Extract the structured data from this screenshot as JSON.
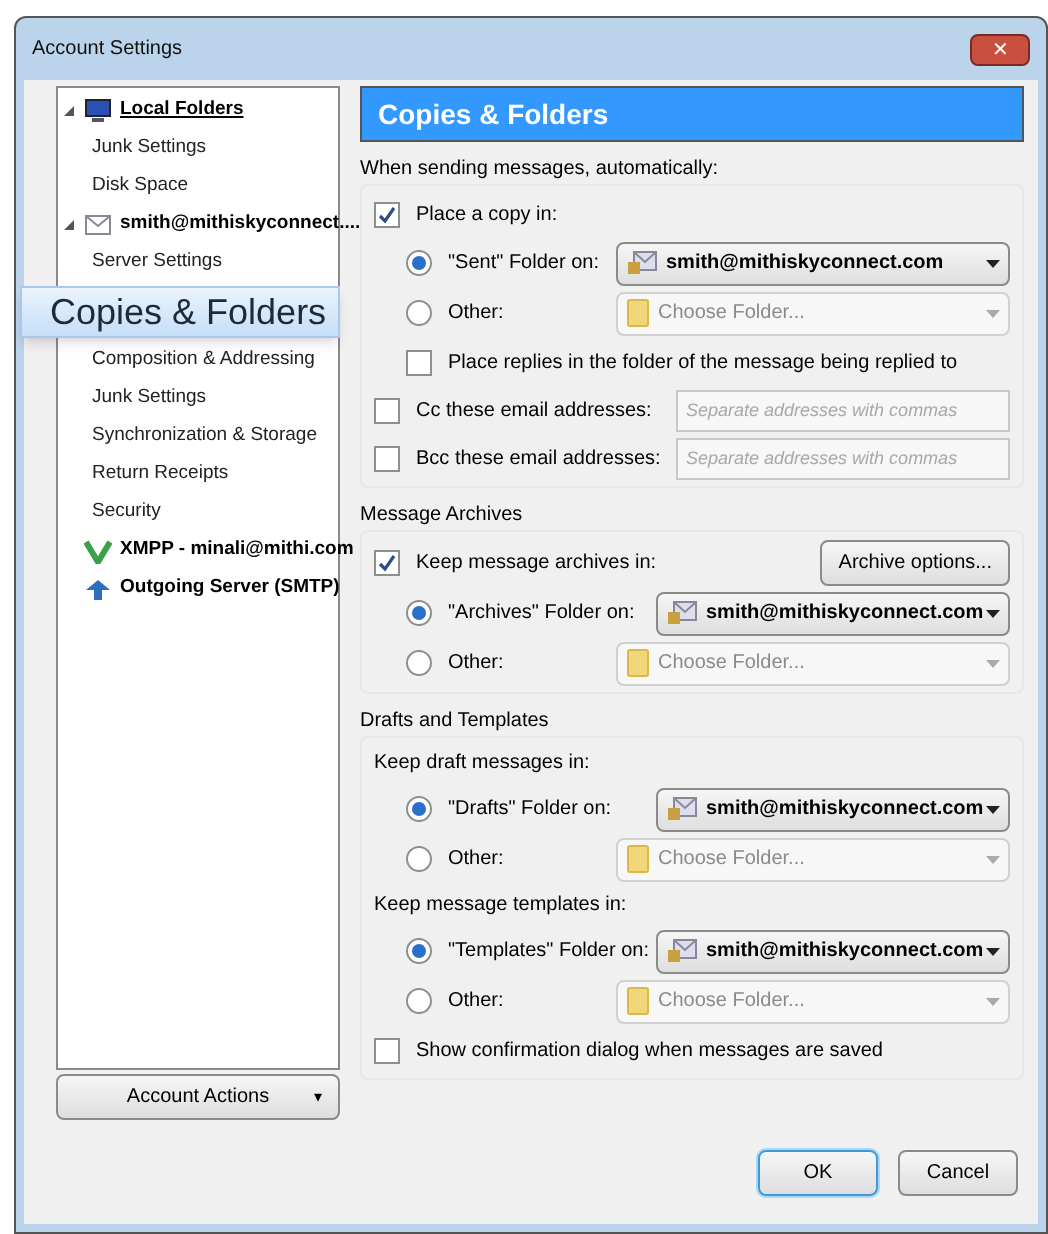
{
  "window": {
    "title": "Account Settings",
    "close": "✕"
  },
  "sidebar": {
    "items": [
      {
        "label": "Local Folders",
        "kind": "local",
        "expanded": true,
        "selected": false,
        "children": [
          {
            "label": "Junk Settings",
            "selected": false
          },
          {
            "label": "Disk Space",
            "selected": false
          }
        ]
      },
      {
        "label": "smith@mithiskyconnect....",
        "kind": "mail",
        "expanded": true,
        "selected": false,
        "children": [
          {
            "label": "Server Settings",
            "selected": false
          },
          {
            "label": "Copies & Folders",
            "selected": true
          },
          {
            "label": "Composition & Addressing",
            "selected": false
          },
          {
            "label": "Junk Settings",
            "selected": false
          },
          {
            "label": "Synchronization & Storage",
            "selected": false
          },
          {
            "label": "Return Receipts",
            "selected": false
          },
          {
            "label": "Security",
            "selected": false
          }
        ]
      },
      {
        "label": "XMPP - minali@mithi.com",
        "kind": "chat",
        "selected": false
      },
      {
        "label": "Outgoing Server (SMTP)",
        "kind": "server",
        "selected": false
      }
    ],
    "actions": "Account Actions",
    "actions_caret": "▾"
  },
  "page": {
    "title": "Copies & Folders",
    "sections": [
      {
        "title": "When sending messages, automatically:",
        "rows": [
          {
            "kind": "checkbox",
            "label": "Place a copy in:",
            "checked": true
          },
          {
            "kind": "radio",
            "label": "\"Sent\" Folder on:",
            "selected": true,
            "select": {
              "kind": "account",
              "value": "smith@mithiskyconnect.com",
              "disabled": false
            }
          },
          {
            "kind": "radio",
            "label": "Other:",
            "selected": false,
            "select": {
              "kind": "folder",
              "value": "Choose Folder...",
              "disabled": true
            }
          },
          {
            "kind": "subcheckbox",
            "label": "Place replies in the folder of the message being replied to",
            "checked": false
          },
          {
            "kind": "checkfield",
            "label": "Cc these email addresses:",
            "checked": false,
            "placeholder": "Separate addresses with commas"
          },
          {
            "kind": "checkfield",
            "label": "Bcc these email addresses:",
            "checked": false,
            "placeholder": "Separate addresses with commas"
          }
        ]
      },
      {
        "title": "Message Archives",
        "rows": [
          {
            "kind": "checkbutton",
            "label": "Keep message archives in:",
            "checked": true,
            "button": "Archive options..."
          },
          {
            "kind": "radio",
            "label": "\"Archives\" Folder on:",
            "selected": true,
            "select": {
              "kind": "account",
              "value": "smith@mithiskyconnect.com",
              "disabled": false
            }
          },
          {
            "kind": "radio",
            "label": "Other:",
            "selected": false,
            "select": {
              "kind": "folder",
              "value": "Choose Folder...",
              "disabled": true
            }
          }
        ]
      },
      {
        "title": "Drafts and Templates",
        "rows": [
          {
            "kind": "label",
            "label": "Keep draft messages in:"
          },
          {
            "kind": "radio",
            "label": "\"Drafts\" Folder on:",
            "selected": true,
            "select": {
              "kind": "account",
              "value": "smith@mithiskyconnect.com",
              "disabled": false
            }
          },
          {
            "kind": "radio",
            "label": "Other:",
            "selected": false,
            "select": {
              "kind": "folder",
              "value": "Choose Folder...",
              "disabled": true
            }
          },
          {
            "kind": "label",
            "label": "Keep message templates in:"
          },
          {
            "kind": "radio",
            "label": "\"Templates\" Folder on:",
            "selected": true,
            "select": {
              "kind": "account",
              "value": "smith@mithiskyconnect.com",
              "disabled": false
            }
          },
          {
            "kind": "radio",
            "label": "Other:",
            "selected": false,
            "select": {
              "kind": "folder",
              "value": "Choose Folder...",
              "disabled": true
            }
          },
          {
            "kind": "checkbox",
            "label": "Show confirmation dialog when messages are saved",
            "checked": false
          }
        ]
      }
    ]
  },
  "buttons": [
    {
      "label": "OK",
      "default": true
    },
    {
      "label": "Cancel",
      "default": false
    }
  ]
}
